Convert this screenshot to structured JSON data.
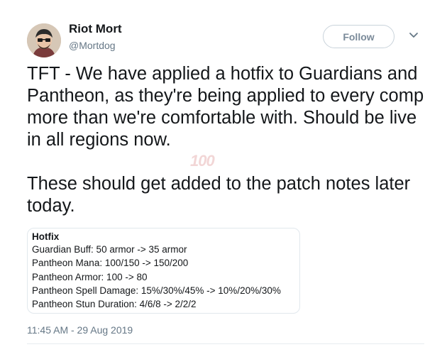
{
  "author": {
    "display_name": "Riot Mort",
    "handle": "@Mortdog"
  },
  "follow_label": "Follow",
  "tweet_text": "TFT - We have applied a hotfix to Guardians and Pantheon, as they're being applied to every comp more than we're comfortable with. Should be live in all regions now.\n\nThese should get added to the patch notes later today.",
  "hotfix_card": {
    "title": "Hotfix",
    "lines": [
      "Guardian Buff: 50 armor -> 35 armor",
      "Pantheon Mana: 100/150 -> 150/200",
      "Pantheon Armor: 100 -> 80",
      "Pantheon Spell Damage: 15%/30%/45% -> 10%/20%/30%",
      "Pantheon Stun Duration: 4/6/8 -> 2/2/2"
    ]
  },
  "timestamp": "11:45 AM - 29 Aug 2019",
  "watermark_text": "100"
}
